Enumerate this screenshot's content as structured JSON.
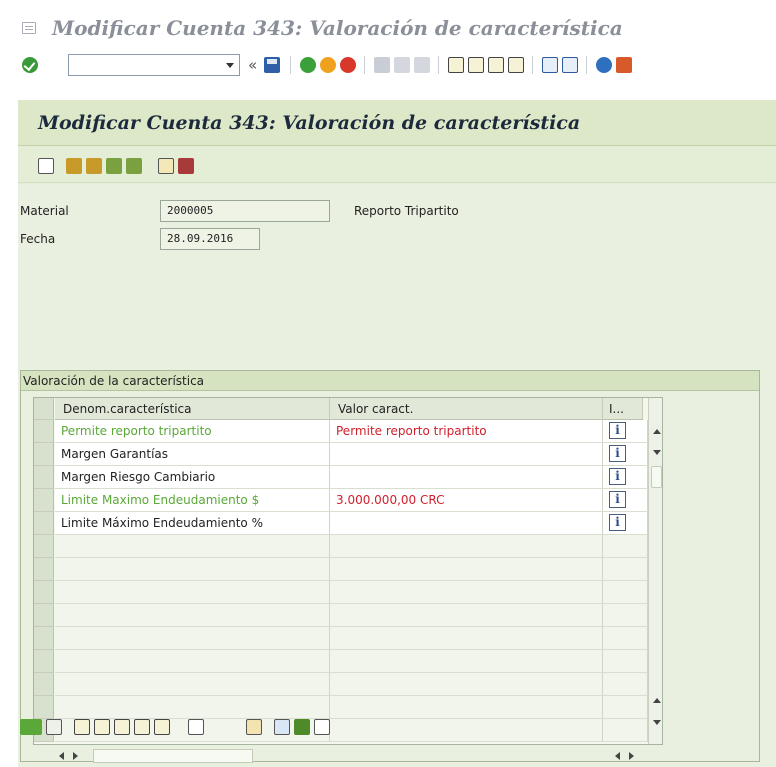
{
  "window": {
    "title": "Modificar Cuenta 343: Valoración de característica"
  },
  "system_toolbar": {
    "command_field": {
      "value": "",
      "placeholder": ""
    },
    "back_label": "«",
    "icons": [
      "enter-icon",
      "save-icon",
      "back-icon",
      "exit-icon",
      "cancel-icon",
      "print-icon",
      "find-icon",
      "find-next-icon",
      "first-page-icon",
      "prev-page-icon",
      "next-page-icon",
      "last-page-icon",
      "new-session-icon",
      "shortcut-icon",
      "help-icon",
      "customize-layout-icon"
    ]
  },
  "app": {
    "title": "Modificar Cuenta 343: Valoración de característica",
    "toolbar_icons": [
      "new-document-icon",
      "hierarchy-icon",
      "hierarchy-expand-icon",
      "characteristic-icon",
      "characteristic-value-icon",
      "copy-icon",
      "delete-icon"
    ]
  },
  "form": {
    "material": {
      "label": "Material",
      "value": "2000005",
      "description": "Reporto Tripartito"
    },
    "fecha": {
      "label": "Fecha",
      "value": "28.09.2016"
    }
  },
  "valuation": {
    "group_title": "Valoración de la característica",
    "columns": [
      "Denom.característica",
      "Valor caract.",
      "I..."
    ],
    "rows": [
      {
        "name": "Permite reporto tripartito",
        "value": "Permite reporto tripartito",
        "info": "i",
        "name_color": "#5aa838",
        "value_color": "#d0202e"
      },
      {
        "name": "Margen Garantías",
        "value": "",
        "info": "i",
        "name_color": "#222222",
        "value_color": "#222222"
      },
      {
        "name": "Margen Riesgo Cambiario",
        "value": "",
        "info": "i",
        "name_color": "#222222",
        "value_color": "#222222"
      },
      {
        "name": "Limite Maximo Endeudamiento $",
        "value": "3.000.000,00 CRC",
        "info": "i",
        "name_color": "#5aa838",
        "value_color": "#d0202e"
      },
      {
        "name": "Limite Máximo Endeudamiento %",
        "value": "",
        "info": "i",
        "name_color": "#222222",
        "value_color": "#222222"
      }
    ],
    "empty_rows": 9
  },
  "bottom_toolbar": {
    "icons": [
      "overview-icon",
      "lock-icon",
      "first-icon",
      "previous-icon",
      "next-icon",
      "last-icon",
      "select-icon",
      "table-settings-icon",
      "find-icon",
      "change-layout-icon",
      "release-icon",
      "documents-icon"
    ]
  },
  "colors": {
    "app_bg": "#e4edd6",
    "title_bar": "#dce8c8",
    "required_green": "#5aa838",
    "value_red": "#d0202e"
  }
}
